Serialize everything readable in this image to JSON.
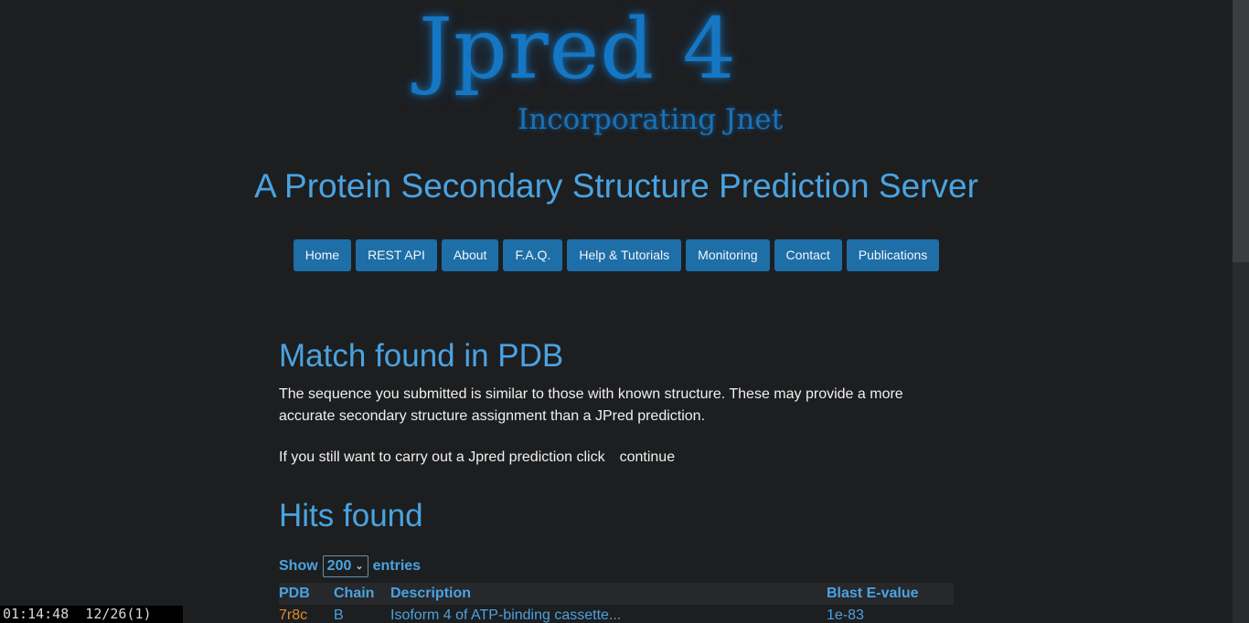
{
  "logo": {
    "main": "Jpred 4",
    "sub": "Incorporating Jnet"
  },
  "header": {
    "title": "A Protein Secondary Structure Prediction Server"
  },
  "nav": {
    "items": [
      {
        "label": "Home"
      },
      {
        "label": "REST API"
      },
      {
        "label": "About"
      },
      {
        "label": "F.A.Q."
      },
      {
        "label": "Help & Tutorials"
      },
      {
        "label": "Monitoring"
      },
      {
        "label": "Contact"
      },
      {
        "label": "Publications"
      }
    ]
  },
  "match": {
    "heading": "Match found in PDB",
    "description": "The sequence you submitted is similar to those with known structure. These may provide a more accurate secondary structure assignment than a JPred prediction.",
    "prompt": "If you still want to carry out a Jpred prediction click",
    "continue_label": "continue"
  },
  "hits": {
    "heading": "Hits found",
    "show_label": "Show",
    "entries_value": "200",
    "entries_label": "entries",
    "columns": [
      "PDB",
      "Chain",
      "Description",
      "Blast E-value"
    ],
    "rows": [
      {
        "pdb": "7r8c",
        "chain": "B",
        "description": "Isoform 4 of ATP-binding cassette...",
        "evalue": "1e-83"
      }
    ]
  },
  "terminal": {
    "text": "01:14:48  12/26(1)"
  },
  "colors": {
    "background": "#1d1e20",
    "accent": "#4aa3e0",
    "nav_button": "#1e6ea7",
    "logo": "#1577c4",
    "pdb_link": "#e08a2e"
  }
}
